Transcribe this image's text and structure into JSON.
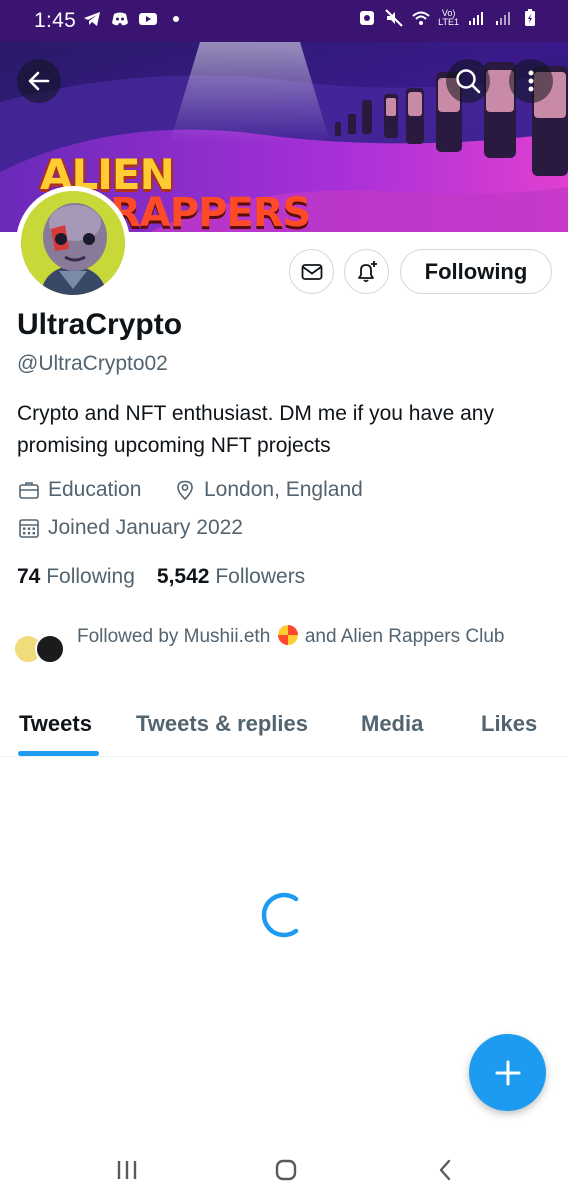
{
  "status_bar": {
    "time": "1:45",
    "network_label_1": "Vo)",
    "network_label_2": "LTE1"
  },
  "banner": {
    "logo_line_1": "ALIEN",
    "logo_line_2": "RAPPERS"
  },
  "header": {
    "back_icon": "arrow-left-icon",
    "search_icon": "search-icon",
    "more_icon": "more-vertical-icon"
  },
  "actions": {
    "message_icon": "mail-icon",
    "notify_icon": "bell-plus-icon",
    "following_label": "Following"
  },
  "profile": {
    "name": "UltraCrypto",
    "handle": "@UltraCrypto02",
    "bio": "Crypto and NFT enthusiast. DM me if you have any promising upcoming NFT projects",
    "category": "Education",
    "location": "London, England",
    "joined": "Joined January 2022"
  },
  "stats": {
    "following_count": "74",
    "following_label": "Following",
    "followers_count": "5,542",
    "followers_label": "Followers"
  },
  "followed_by": {
    "prefix": "Followed by Mushii.eth",
    "suffix": "and Alien Rappers Club"
  },
  "tabs": [
    {
      "label": "Tweets",
      "active": true
    },
    {
      "label": "Tweets & replies",
      "active": false
    },
    {
      "label": "Media",
      "active": false
    },
    {
      "label": "Likes",
      "active": false
    }
  ],
  "colors": {
    "accent": "#1d9bf0",
    "status_bar_bg": "#3a1470",
    "text_primary": "#0f1419",
    "text_secondary": "#536471"
  },
  "fab": {
    "icon": "plus-icon"
  },
  "nav_bar": {
    "recent_icon": "recent-apps-icon",
    "home_icon": "home-icon",
    "back_icon": "back-chevron-icon"
  }
}
